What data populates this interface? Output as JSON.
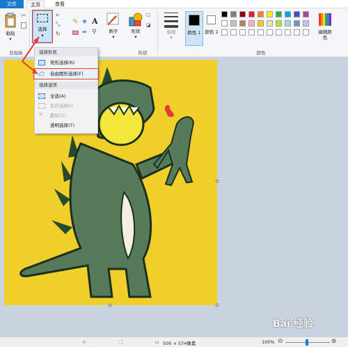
{
  "menubar": {
    "file_label": "文件",
    "home_label": "主页",
    "view_label": "查看"
  },
  "ribbon": {
    "paste_label": "粘贴",
    "clipboard_group": "剪贴板",
    "select_label": "选择",
    "brush_label": "刷子",
    "shapes_label": "形状",
    "shapes_group": "形状",
    "outline_label": "粗细",
    "color1_label": "颜色 1",
    "color2_label": "颜色 2",
    "edit_colors_label": "编辑颜色",
    "colors_group": "颜色",
    "palette_row1": [
      "#000000",
      "#7f7f7f",
      "#880015",
      "#ed1c24",
      "#ff7f27",
      "#fff200",
      "#22b14c",
      "#00a2e8",
      "#3f48cc",
      "#a349a4"
    ],
    "palette_row2": [
      "#ffffff",
      "#c3c3c3",
      "#b97a57",
      "#ffaec9",
      "#ffc90e",
      "#efe4b0",
      "#b5e61d",
      "#99d9ea",
      "#7092be",
      "#c8bfe7"
    ],
    "palette_row3": [
      "#ffffff",
      "#ffffff",
      "#ffffff",
      "#ffffff",
      "#ffffff",
      "#ffffff",
      "#ffffff",
      "#ffffff",
      "#ffffff",
      "#ffffff"
    ]
  },
  "dropdown": {
    "shapes_header": "选择形状",
    "rect_select": "矩形选择(R)",
    "free_select": "自由图形选择(F)",
    "options_header": "选择选项",
    "select_all": "全选(A)",
    "invert_select": "反向选择(I)",
    "delete": "删除(D)",
    "transparent_select": "透明选择(T)"
  },
  "statusbar": {
    "image_size": "500 × 574像素",
    "zoom": "100%"
  },
  "watermark": "Bai 经验"
}
